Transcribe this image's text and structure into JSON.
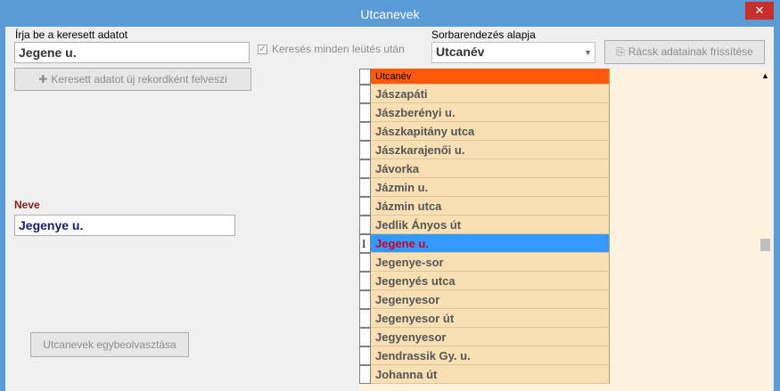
{
  "window": {
    "title": "Utcanevek",
    "close_glyph": "✕"
  },
  "search": {
    "label": "Írja be a keresett adatot",
    "value": "Jegene u.",
    "incremental_label": "Keresés minden leütés után",
    "add_button_label": "Keresett adatot új rekordként felveszi",
    "add_icon": "plus-icon"
  },
  "sort": {
    "label": "Sorbarendezés alapja",
    "selected": "Utcanév",
    "refresh_label": "Rácsk adatainak frissítése",
    "refresh_icon": "refresh-icon"
  },
  "detail": {
    "name_label": "Neve",
    "name_value": "Jegenye u.",
    "merge_button_label": "Utcanevek egybeolvasztása"
  },
  "grid": {
    "column_header": "Utcanév",
    "rows": [
      "Jászapáti",
      "Jászberényi u.",
      "Jászkapitány utca",
      "Jászkarajenői u.",
      "Jávorka",
      "Jázmin u.",
      "Jázmin utca",
      "Jedlik Ányos út",
      "Jegene u.",
      "Jegenye-sor",
      "Jegenyés utca",
      "Jegenyesor",
      "Jegenyesor út",
      "Jegyenyesor",
      "Jendrassik Gy. u.",
      "Johanna út"
    ],
    "selected_row": 8,
    "row_marker": "I"
  },
  "colors": {
    "titlebar": "#5b9bd5",
    "header": "#ff5a0a",
    "row": "#f9dfb4",
    "selected": "#3399ff",
    "selected_text": "#d1001c",
    "name_label": "#8b1a1a"
  }
}
